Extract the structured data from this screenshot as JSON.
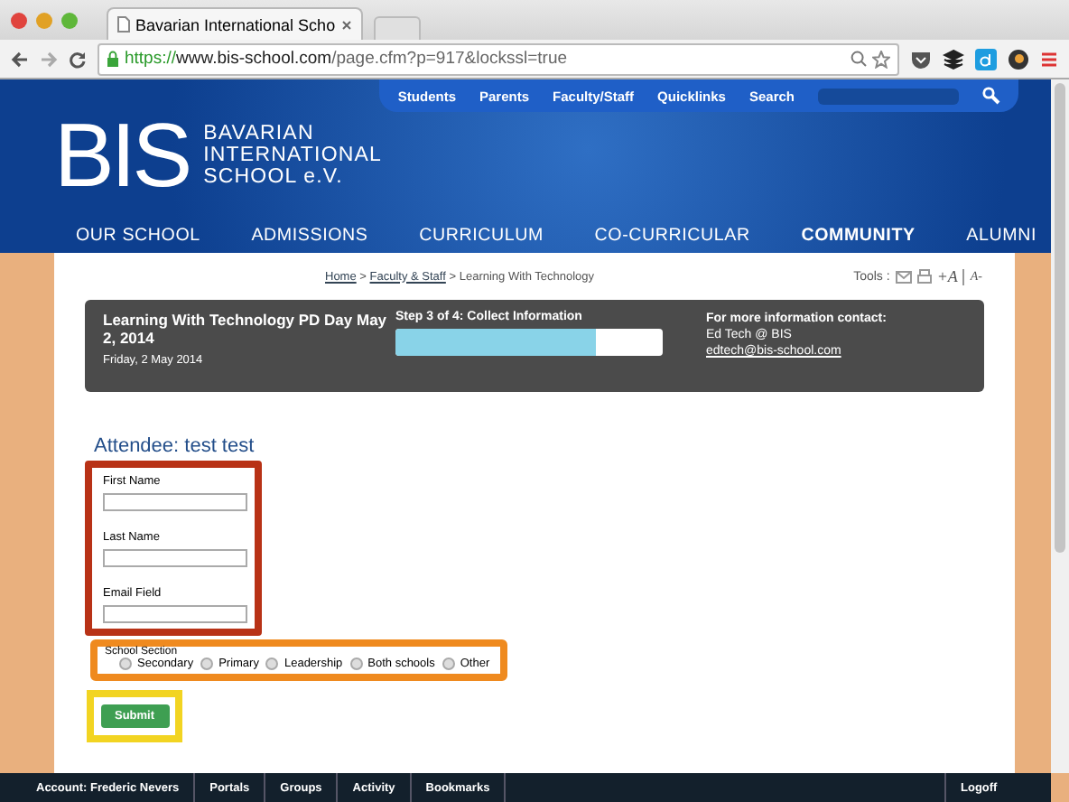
{
  "browser": {
    "tab_title": "Bavarian International Scho",
    "url_scheme": "https://",
    "url_host": "www.bis-school.com",
    "url_path": "/page.cfm?p=917&lockssl=true"
  },
  "utility_nav": [
    "Students",
    "Parents",
    "Faculty/Staff",
    "Quicklinks",
    "Search"
  ],
  "logo": {
    "mark": "BIS",
    "lines": [
      "BAVARIAN",
      "INTERNATIONAL",
      "SCHOOL e.V."
    ]
  },
  "main_nav": [
    {
      "label": "OUR SCHOOL",
      "selected": false
    },
    {
      "label": "ADMISSIONS",
      "selected": false
    },
    {
      "label": "CURRICULUM",
      "selected": false
    },
    {
      "label": "CO-CURRICULAR",
      "selected": false
    },
    {
      "label": "COMMUNITY",
      "selected": true
    },
    {
      "label": "ALUMNI",
      "selected": false
    }
  ],
  "breadcrumb": {
    "links": [
      "Home",
      "Faculty & Staff"
    ],
    "separator": ">",
    "current": "Learning With Technology"
  },
  "tools": {
    "label": "Tools :",
    "increase": "+A",
    "decrease": "A-"
  },
  "event": {
    "title": "Learning With Technology PD Day May 2, 2014",
    "date": "Friday, 2 May 2014",
    "step": "Step 3 of 4: Collect Information",
    "level": 0.75,
    "contact_label": "For more information contact:",
    "contact_name": "Ed Tech @ BIS",
    "contact_email": "edtech@bis-school.com"
  },
  "attendee": "Attendee: test test",
  "fields": [
    {
      "label": "First Name"
    },
    {
      "label": "Last Name"
    },
    {
      "label": "Email Field"
    }
  ],
  "school_section": {
    "label": "School Section",
    "options": [
      {
        "label": "Secondary",
        "selected": false
      },
      {
        "label": "Primary",
        "selected": false
      },
      {
        "label": "Leadership",
        "selected": false
      },
      {
        "label": "Both schools",
        "selected": false
      },
      {
        "label": "Other",
        "selected": false
      }
    ]
  },
  "submit": "Submit",
  "footer": {
    "items": [
      "Account: Frederic Nevers",
      "Portals",
      "Groups",
      "Activity",
      "Bookmarks"
    ],
    "logoff": "Logoff"
  }
}
